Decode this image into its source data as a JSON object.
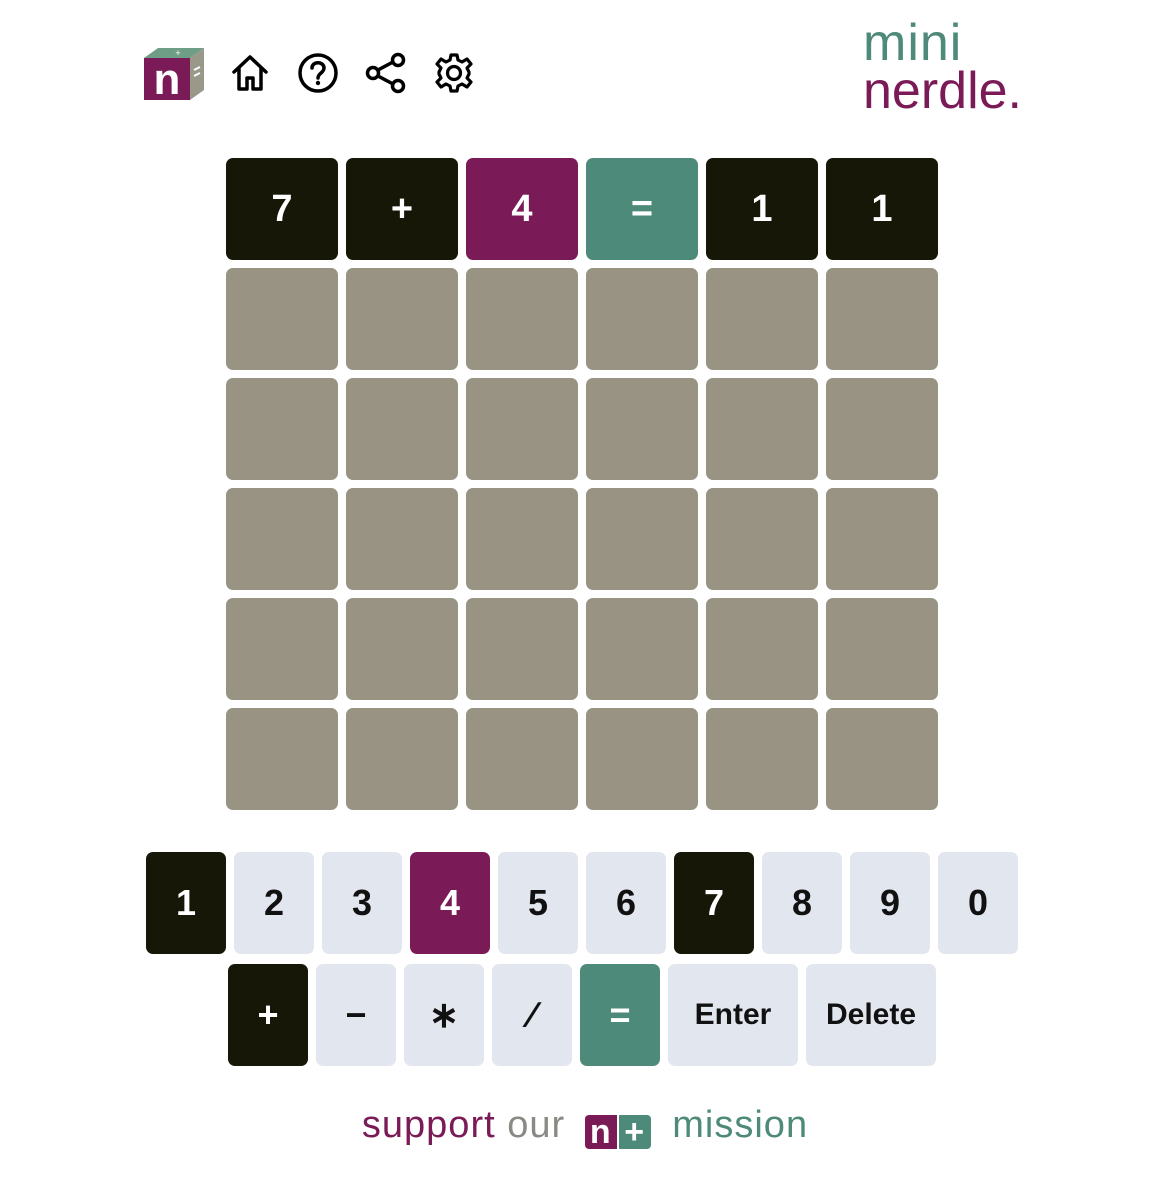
{
  "header": {
    "logo": {
      "letter": "n",
      "cube_marks": "+ ="
    },
    "icons": [
      "home-icon",
      "help-icon",
      "share-icon",
      "settings-icon"
    ],
    "brand_line1": "mini",
    "brand_line2": "nerdle."
  },
  "board": {
    "rows": [
      [
        {
          "v": "7",
          "s": "black"
        },
        {
          "v": "+",
          "s": "black"
        },
        {
          "v": "4",
          "s": "purple"
        },
        {
          "v": "=",
          "s": "green"
        },
        {
          "v": "1",
          "s": "black"
        },
        {
          "v": "1",
          "s": "black"
        }
      ],
      [
        {
          "v": "",
          "s": "empty"
        },
        {
          "v": "",
          "s": "empty"
        },
        {
          "v": "",
          "s": "empty"
        },
        {
          "v": "",
          "s": "empty"
        },
        {
          "v": "",
          "s": "empty"
        },
        {
          "v": "",
          "s": "empty"
        }
      ],
      [
        {
          "v": "",
          "s": "empty"
        },
        {
          "v": "",
          "s": "empty"
        },
        {
          "v": "",
          "s": "empty"
        },
        {
          "v": "",
          "s": "empty"
        },
        {
          "v": "",
          "s": "empty"
        },
        {
          "v": "",
          "s": "empty"
        }
      ],
      [
        {
          "v": "",
          "s": "empty"
        },
        {
          "v": "",
          "s": "empty"
        },
        {
          "v": "",
          "s": "empty"
        },
        {
          "v": "",
          "s": "empty"
        },
        {
          "v": "",
          "s": "empty"
        },
        {
          "v": "",
          "s": "empty"
        }
      ],
      [
        {
          "v": "",
          "s": "empty"
        },
        {
          "v": "",
          "s": "empty"
        },
        {
          "v": "",
          "s": "empty"
        },
        {
          "v": "",
          "s": "empty"
        },
        {
          "v": "",
          "s": "empty"
        },
        {
          "v": "",
          "s": "empty"
        }
      ],
      [
        {
          "v": "",
          "s": "empty"
        },
        {
          "v": "",
          "s": "empty"
        },
        {
          "v": "",
          "s": "empty"
        },
        {
          "v": "",
          "s": "empty"
        },
        {
          "v": "",
          "s": "empty"
        },
        {
          "v": "",
          "s": "empty"
        }
      ]
    ]
  },
  "keyboard": {
    "numbers": [
      {
        "label": "1",
        "state": "black"
      },
      {
        "label": "2",
        "state": "unused"
      },
      {
        "label": "3",
        "state": "unused"
      },
      {
        "label": "4",
        "state": "purple"
      },
      {
        "label": "5",
        "state": "unused"
      },
      {
        "label": "6",
        "state": "unused"
      },
      {
        "label": "7",
        "state": "black"
      },
      {
        "label": "8",
        "state": "unused"
      },
      {
        "label": "9",
        "state": "unused"
      },
      {
        "label": "0",
        "state": "unused"
      }
    ],
    "operators": [
      {
        "label": "+",
        "state": "black"
      },
      {
        "label": "−",
        "state": "unused"
      },
      {
        "label": "∗",
        "state": "unused"
      },
      {
        "label": "∕",
        "state": "unused"
      },
      {
        "label": "=",
        "state": "green"
      }
    ],
    "enter_label": "Enter",
    "delete_label": "Delete"
  },
  "footer": {
    "word1": "support",
    "word2": "our",
    "badge_n": "n",
    "badge_plus": "+",
    "word3": "mission"
  },
  "colors": {
    "black_tile": "#171708",
    "purple_tile": "#7a1b57",
    "green_tile": "#4e8a79",
    "empty_tile": "#989382",
    "key_default": "#e2e6ee"
  }
}
